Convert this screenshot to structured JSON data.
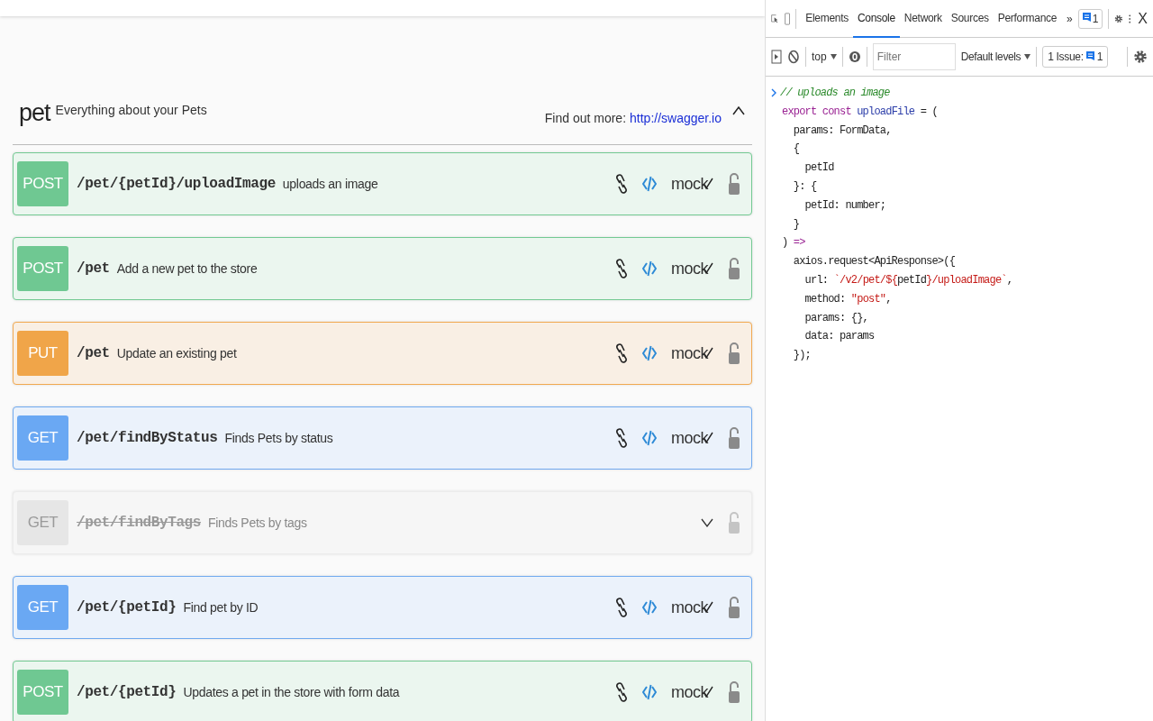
{
  "tag": {
    "name": "pet",
    "description": "Everything about your Pets",
    "find_out_more": "Find out more:",
    "link": "http://swagger.io",
    "expanded": true
  },
  "operations": [
    {
      "method": "POST",
      "path": "/pet/{petId}/uploadImage",
      "summary": "uploads an image",
      "deprecated": false,
      "mock": "mock"
    },
    {
      "method": "POST",
      "path": "/pet",
      "summary": "Add a new pet to the store",
      "deprecated": false,
      "mock": "mock"
    },
    {
      "method": "PUT",
      "path": "/pet",
      "summary": "Update an existing pet",
      "deprecated": false,
      "mock": "mock"
    },
    {
      "method": "GET",
      "path": "/pet/findByStatus",
      "summary": "Finds Pets by status",
      "deprecated": false,
      "mock": "mock"
    },
    {
      "method": "GET",
      "path": "/pet/findByTags",
      "summary": "Finds Pets by tags",
      "deprecated": true
    },
    {
      "method": "GET",
      "path": "/pet/{petId}",
      "summary": "Find pet by ID",
      "deprecated": false,
      "mock": "mock"
    },
    {
      "method": "POST",
      "path": "/pet/{petId}",
      "summary": "Updates a pet in the store with form data",
      "deprecated": false,
      "mock": "mock"
    }
  ],
  "devtools": {
    "tabs": [
      {
        "label": "Elements",
        "selected": false
      },
      {
        "label": "Console",
        "selected": true
      },
      {
        "label": "Network",
        "selected": false
      },
      {
        "label": "Sources",
        "selected": false
      },
      {
        "label": "Performance",
        "selected": false
      }
    ],
    "more_tabs": "»",
    "issues_badge": "1",
    "close": "X",
    "context": "top",
    "filter": {
      "placeholder": "Filter"
    },
    "levels": "Default levels",
    "issues_label": "1 Issue:",
    "issues_count": "1",
    "console_lines": [
      [
        {
          "text": "// uploads an image",
          "kind": "comment"
        }
      ],
      [
        {
          "text": "export const ",
          "kind": "keyword"
        },
        {
          "text": "uploadFile",
          "kind": "def"
        },
        {
          "text": " = (",
          "kind": "plain"
        }
      ],
      [
        {
          "text": "  params: FormData,",
          "kind": "plain"
        }
      ],
      [
        {
          "text": "  {",
          "kind": "plain"
        }
      ],
      [
        {
          "text": "    petId",
          "kind": "plain"
        }
      ],
      [
        {
          "text": "  }: {",
          "kind": "plain"
        }
      ],
      [
        {
          "text": "    petId: number;",
          "kind": "plain"
        }
      ],
      [
        {
          "text": "  }",
          "kind": "plain"
        }
      ],
      [
        {
          "text": ") ",
          "kind": "plain"
        },
        {
          "text": "=>",
          "kind": "keyword"
        }
      ],
      [
        {
          "text": "  axios.request<ApiResponse>({",
          "kind": "plain"
        }
      ],
      [
        {
          "text": "    url: ",
          "kind": "plain"
        },
        {
          "text": "`/v2/pet/${",
          "kind": "string"
        },
        {
          "text": "petId",
          "kind": "plain"
        },
        {
          "text": "}/uploadImage`",
          "kind": "string"
        },
        {
          "text": ",",
          "kind": "plain"
        }
      ],
      [
        {
          "text": "    method: ",
          "kind": "plain"
        },
        {
          "text": "\"post\"",
          "kind": "string"
        },
        {
          "text": ",",
          "kind": "plain"
        }
      ],
      [
        {
          "text": "    params: {},",
          "kind": "plain"
        }
      ],
      [
        {
          "text": "    data: params",
          "kind": "plain"
        }
      ],
      [
        {
          "text": "  });",
          "kind": "plain"
        }
      ]
    ]
  }
}
